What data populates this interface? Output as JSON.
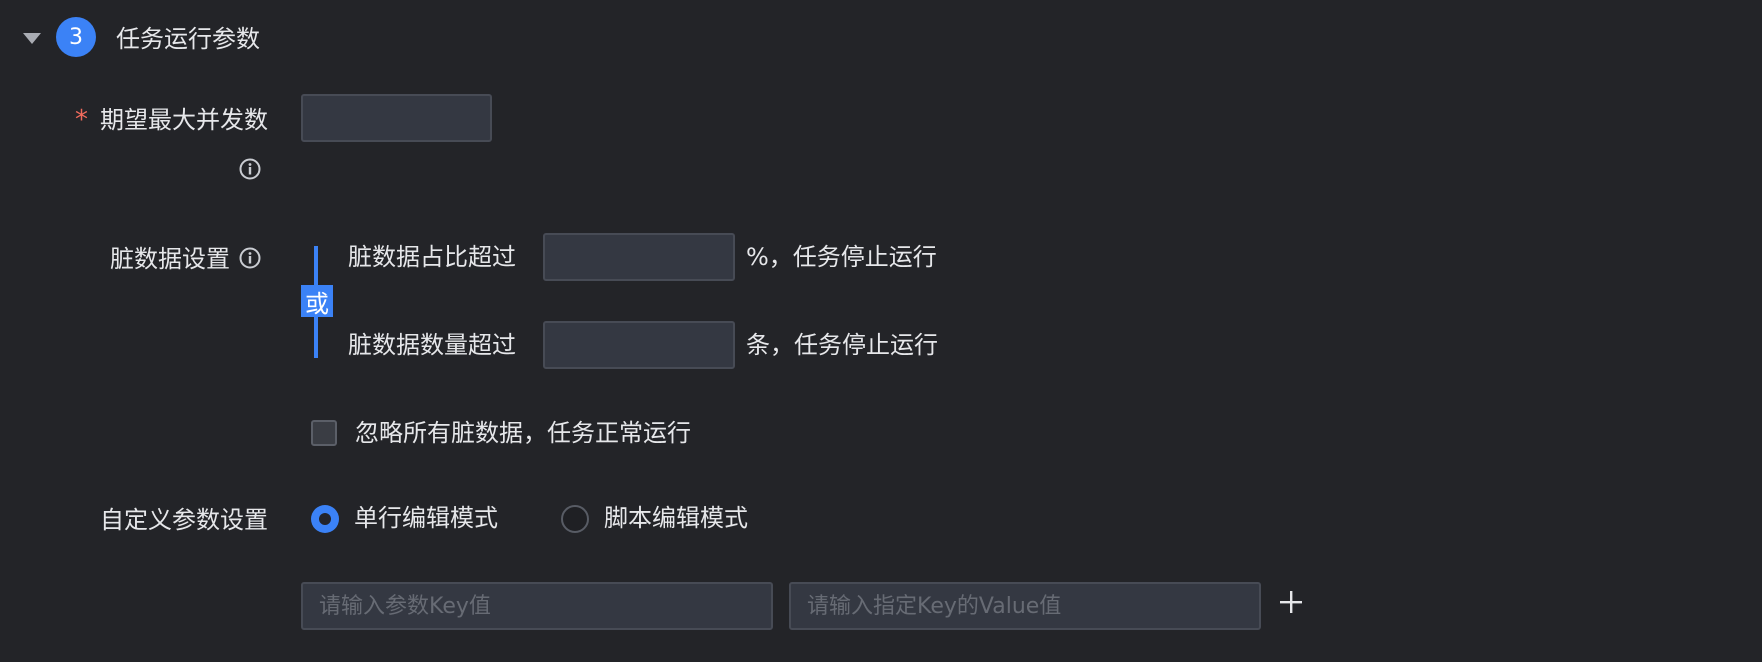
{
  "section": {
    "step_number": "3",
    "title": "任务运行参数"
  },
  "fields": {
    "required_mark": "*",
    "max_concurrency_label": "期望最大并发数",
    "max_concurrency_value": "",
    "dirty_data_label": "脏数据设置",
    "or_label": "或",
    "dirty_ratio_prefix": "脏数据占比超过",
    "dirty_ratio_value": "",
    "dirty_ratio_suffix": "%，任务停止运行",
    "dirty_count_prefix": "脏数据数量超过",
    "dirty_count_value": "",
    "dirty_count_suffix": "条，任务停止运行",
    "ignore_dirty_label": "忽略所有脏数据，任务正常运行",
    "ignore_dirty_checked": false,
    "custom_params_label": "自定义参数设置",
    "mode_single_line": "单行编辑模式",
    "mode_script": "脚本编辑模式",
    "selected_mode": "单行编辑模式",
    "param_key_placeholder": "请输入参数Key值",
    "param_value_placeholder": "请输入指定Key的Value值"
  },
  "colors": {
    "background": "#232428",
    "accent": "#3b82f6",
    "required": "#f16b5d",
    "input_bg": "#343842"
  },
  "icons": [
    "caret-down-icon",
    "info-icon",
    "plus-icon"
  ]
}
